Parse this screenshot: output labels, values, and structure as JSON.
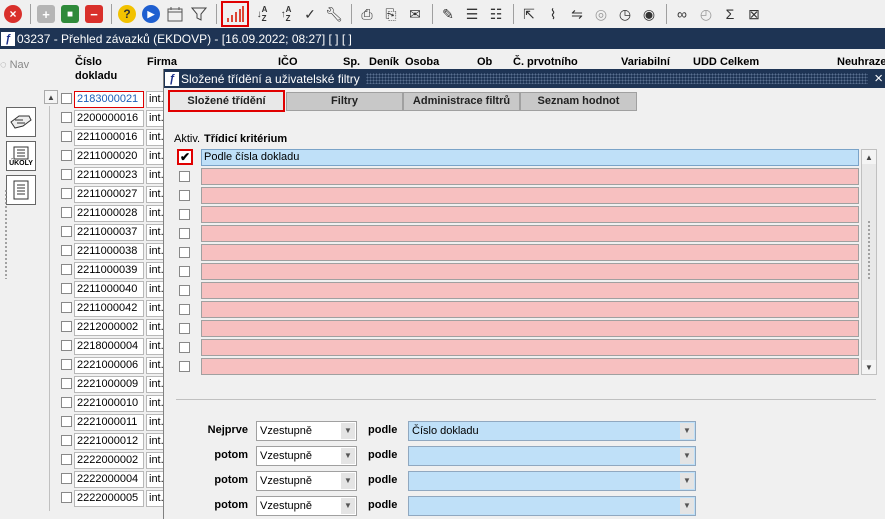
{
  "toolbar": {
    "icons": [
      "cancel-icon",
      "add-icon",
      "save-icon",
      "delete-icon",
      "help-icon",
      "run-icon",
      "calendar-icon",
      "filter-icon",
      "chart-icon",
      "sort-asc-icon",
      "sort-desc-icon",
      "check-icon",
      "wrench-icon",
      "print-icon",
      "print-preview-icon",
      "mail-icon",
      "edit-icon",
      "list-icon",
      "checklist-icon",
      "export-icon",
      "attach-icon",
      "link-icon",
      "globe-icon",
      "compass-icon",
      "eye-icon",
      "glasses-icon",
      "clock-icon",
      "sum-icon",
      "excel-icon"
    ]
  },
  "window": {
    "title": "03237 - Přehled závazků (EKDOVP) - [16.09.2022; 08:27]  [ ]  [ ]"
  },
  "left_panel": {
    "nav_label": "Nav",
    "tasks_label": "ÚKOLY"
  },
  "columns": {
    "cislo": "Číslo",
    "dokladu": "dokladu",
    "firma": "Firma",
    "ico": "IČO",
    "sp": "Sp.",
    "denik": "Deník",
    "osoba": "Osoba",
    "ob": "Ob",
    "c_prvotniho": "Č. prvotního",
    "variabilni": "Variabilní",
    "udd": "UDD",
    "celkem": "Celkem",
    "neuhraz": "Neuhraze"
  },
  "rows": [
    {
      "num": "2183000021",
      "firm": "int."
    },
    {
      "num": "2200000016",
      "firm": "int."
    },
    {
      "num": "2211000016",
      "firm": "int."
    },
    {
      "num": "2211000020",
      "firm": "int."
    },
    {
      "num": "2211000023",
      "firm": "int."
    },
    {
      "num": "2211000027",
      "firm": "int."
    },
    {
      "num": "2211000028",
      "firm": "int."
    },
    {
      "num": "2211000037",
      "firm": "int."
    },
    {
      "num": "2211000038",
      "firm": "int."
    },
    {
      "num": "2211000039",
      "firm": "int."
    },
    {
      "num": "2211000040",
      "firm": "int."
    },
    {
      "num": "2211000042",
      "firm": "int."
    },
    {
      "num": "2212000002",
      "firm": "int."
    },
    {
      "num": "2218000004",
      "firm": "int."
    },
    {
      "num": "2221000006",
      "firm": "int."
    },
    {
      "num": "2221000009",
      "firm": "int."
    },
    {
      "num": "2221000010",
      "firm": "int."
    },
    {
      "num": "2221000011",
      "firm": "int."
    },
    {
      "num": "2221000012",
      "firm": "int."
    },
    {
      "num": "2222000002",
      "firm": "int."
    },
    {
      "num": "2222000004",
      "firm": "int."
    },
    {
      "num": "2222000005",
      "firm": "int."
    }
  ],
  "dialog": {
    "title": "Složené třídění a uživatelské filtry",
    "close": "×",
    "tabs": [
      "Složené třídění",
      "Filtry",
      "Administrace filtrů",
      "Seznam hodnot"
    ],
    "active_tab": "Složené třídění",
    "aktiv_header": "Aktiv.",
    "criterion_header": "Třídicí kritérium",
    "criteria": [
      {
        "active": true,
        "text": "Podle čísla dokladu"
      },
      {
        "active": false,
        "text": ""
      },
      {
        "active": false,
        "text": ""
      },
      {
        "active": false,
        "text": ""
      },
      {
        "active": false,
        "text": ""
      },
      {
        "active": false,
        "text": ""
      },
      {
        "active": false,
        "text": ""
      },
      {
        "active": false,
        "text": ""
      },
      {
        "active": false,
        "text": ""
      },
      {
        "active": false,
        "text": ""
      },
      {
        "active": false,
        "text": ""
      },
      {
        "active": false,
        "text": ""
      }
    ],
    "sort": [
      {
        "label": "Nejprve",
        "order": "Vzestupně",
        "by_label": "podle",
        "field": "Číslo dokladu"
      },
      {
        "label": "potom",
        "order": "Vzestupně",
        "by_label": "podle",
        "field": ""
      },
      {
        "label": "potom",
        "order": "Vzestupně",
        "by_label": "podle",
        "field": ""
      },
      {
        "label": "potom",
        "order": "Vzestupně",
        "by_label": "podle",
        "field": ""
      }
    ]
  },
  "colors": {
    "titlebar": "#1e3454",
    "highlight": "#e00000",
    "criterion_empty": "#f7c0c0",
    "criterion_active": "#bfe0f8"
  }
}
